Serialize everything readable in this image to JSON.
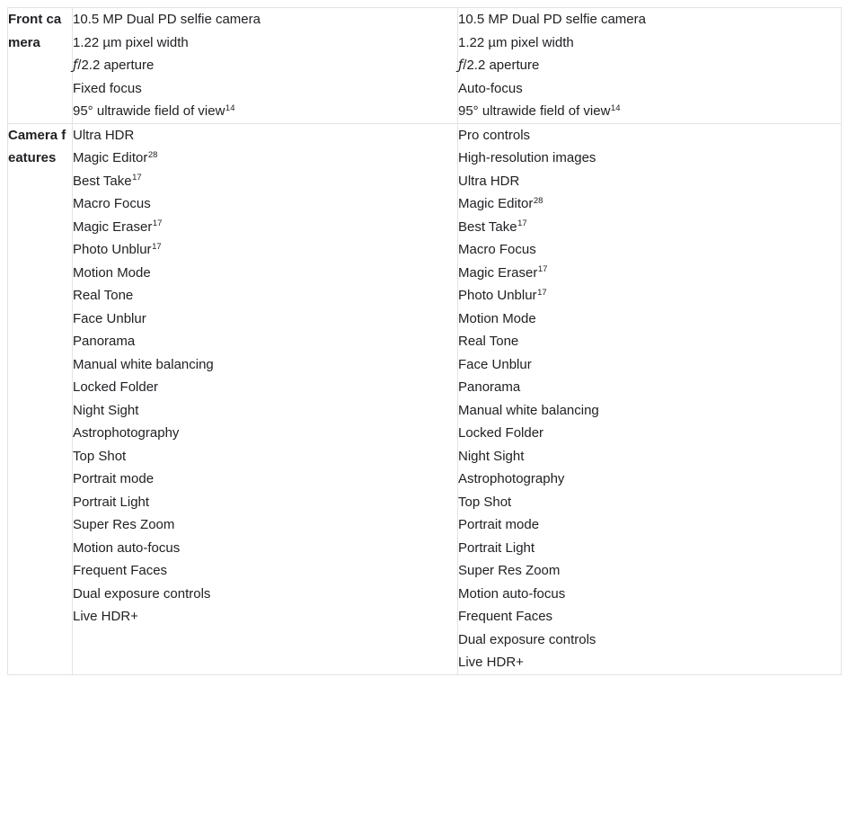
{
  "table": {
    "rows": [
      {
        "label": "Front camera",
        "columns": [
          {
            "items": [
              {
                "text": "10.5 MP Dual PD selfie camera"
              },
              {
                "text": "1.22 µm pixel width"
              },
              {
                "text": "ƒ/2.2 aperture",
                "florin": true,
                "rest": "/2.2 aperture"
              },
              {
                "text": "Fixed focus"
              },
              {
                "text": "95° ultrawide field of view",
                "sup": "14"
              }
            ]
          },
          {
            "items": [
              {
                "text": "10.5 MP Dual PD selfie camera"
              },
              {
                "text": "1.22 µm pixel width"
              },
              {
                "text": "ƒ/2.2 aperture",
                "florin": true,
                "rest": "/2.2 aperture"
              },
              {
                "text": "Auto-focus"
              },
              {
                "text": "95° ultrawide field of view",
                "sup": "14"
              }
            ]
          }
        ]
      },
      {
        "label": "Camera features",
        "columns": [
          {
            "items": [
              {
                "text": "Ultra HDR"
              },
              {
                "text": "Magic Editor",
                "sup": "28"
              },
              {
                "text": "Best Take",
                "sup": "17"
              },
              {
                "text": "Macro Focus"
              },
              {
                "text": "Magic Eraser",
                "sup": "17"
              },
              {
                "text": "Photo Unblur",
                "sup": "17"
              },
              {
                "text": "Motion Mode"
              },
              {
                "text": "Real Tone"
              },
              {
                "text": "Face Unblur"
              },
              {
                "text": "Panorama"
              },
              {
                "text": "Manual white balancing"
              },
              {
                "text": "Locked Folder"
              },
              {
                "text": "Night Sight"
              },
              {
                "text": "Astrophotography"
              },
              {
                "text": "Top Shot"
              },
              {
                "text": "Portrait mode"
              },
              {
                "text": "Portrait Light"
              },
              {
                "text": "Super Res Zoom"
              },
              {
                "text": "Motion auto-focus"
              },
              {
                "text": "Frequent Faces"
              },
              {
                "text": "Dual exposure controls"
              },
              {
                "text": "Live HDR+"
              }
            ]
          },
          {
            "items": [
              {
                "text": "Pro controls"
              },
              {
                "text": "High-resolution images"
              },
              {
                "text": "Ultra HDR"
              },
              {
                "text": "Magic Editor",
                "sup": "28"
              },
              {
                "text": "Best Take",
                "sup": "17"
              },
              {
                "text": "Macro Focus"
              },
              {
                "text": "Magic Eraser",
                "sup": "17"
              },
              {
                "text": "Photo Unblur",
                "sup": "17"
              },
              {
                "text": "Motion Mode"
              },
              {
                "text": "Real Tone"
              },
              {
                "text": "Face Unblur"
              },
              {
                "text": "Panorama"
              },
              {
                "text": "Manual white balancing"
              },
              {
                "text": "Locked Folder"
              },
              {
                "text": "Night Sight"
              },
              {
                "text": "Astrophotography"
              },
              {
                "text": "Top Shot"
              },
              {
                "text": "Portrait mode"
              },
              {
                "text": "Portrait Light"
              },
              {
                "text": "Super Res Zoom"
              },
              {
                "text": "Motion auto-focus"
              },
              {
                "text": "Frequent Faces"
              },
              {
                "text": "Dual exposure controls"
              },
              {
                "text": "Live HDR+"
              }
            ]
          }
        ]
      }
    ]
  },
  "colors": {
    "text": "#202124",
    "border": "#e3e3e3",
    "background": "#ffffff"
  }
}
